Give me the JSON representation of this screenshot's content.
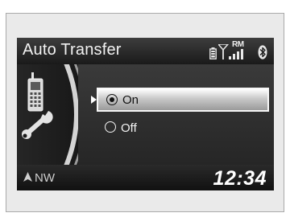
{
  "screen": {
    "title": "Auto Transfer",
    "status": {
      "roaming_text": "RM"
    }
  },
  "menu": {
    "options": [
      {
        "label": "On",
        "selected": true
      },
      {
        "label": "Off",
        "selected": false
      }
    ]
  },
  "footer": {
    "compass_heading": "NW",
    "clock": "12:34"
  },
  "icons": {
    "phone_settings": "phone-wrench-icon",
    "battery": "battery-icon",
    "signal": "signal-strength-icon",
    "bluetooth": "bluetooth-icon",
    "compass_arrow": "compass-arrow-icon"
  },
  "colors": {
    "screen_background": "#1e1e1e",
    "header_text": "#f2f2f2",
    "highlight": "#e6e6e6",
    "frame": "#eaeaea"
  }
}
